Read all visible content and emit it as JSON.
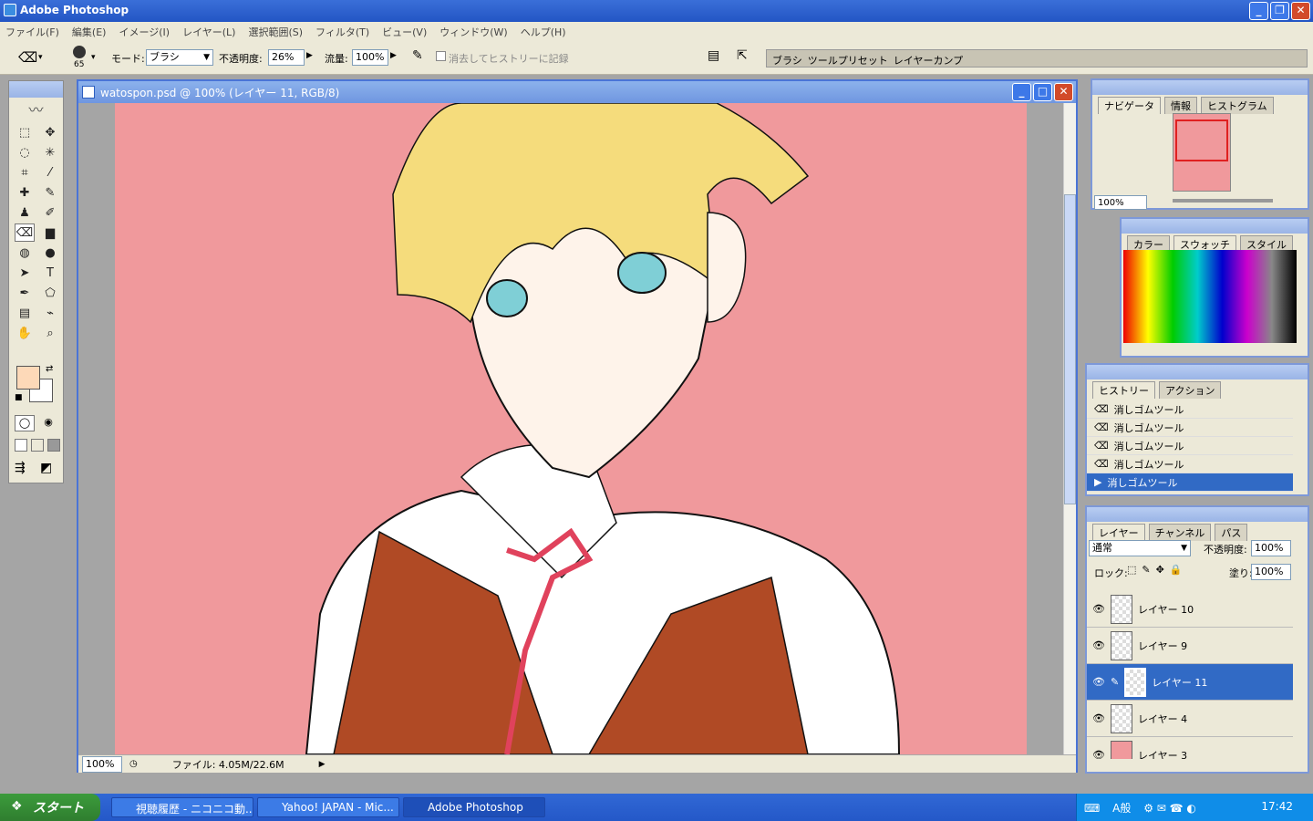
{
  "app": {
    "title": "Adobe Photoshop"
  },
  "menu": [
    "ファイル(F)",
    "編集(E)",
    "イメージ(I)",
    "レイヤー(L)",
    "選択範囲(S)",
    "フィルタ(T)",
    "ビュー(V)",
    "ウィンドウ(W)",
    "ヘルプ(H)"
  ],
  "options": {
    "brush_size": "65",
    "mode_label": "モード:",
    "mode_value": "ブラシ",
    "opacity_label": "不透明度:",
    "opacity_value": "26%",
    "flow_label": "流量:",
    "flow_value": "100%",
    "erase_history_label": "消去してヒストリーに記録",
    "well_tabs": [
      "ブラシ",
      "ツールプリセット",
      "レイヤーカンプ"
    ]
  },
  "document": {
    "title": "watospon.psd @ 100% (レイヤー 11, RGB/8)",
    "zoom": "100%",
    "file_info": "ファイル: 4.05M/22.6M"
  },
  "navigator": {
    "tabs": [
      "ナビゲータ",
      "情報",
      "ヒストグラム"
    ],
    "zoom": "100%"
  },
  "swatches": {
    "tabs": [
      "カラー",
      "スウォッチ",
      "スタイル"
    ]
  },
  "history": {
    "tabs": [
      "ヒストリー",
      "アクション"
    ],
    "items": [
      "消しゴムツール",
      "消しゴムツール",
      "消しゴムツール",
      "消しゴムツール",
      "消しゴムツール"
    ]
  },
  "layers": {
    "tabs": [
      "レイヤー",
      "チャンネル",
      "パス"
    ],
    "blend_mode": "通常",
    "opacity_label": "不透明度:",
    "opacity_value": "100%",
    "lock_label": "ロック:",
    "fill_label": "塗り:",
    "fill_value": "100%",
    "items": [
      "レイヤー 10",
      "レイヤー 9",
      "レイヤー 11",
      "レイヤー 4",
      "レイヤー 3"
    ]
  },
  "taskbar": {
    "start": "スタート",
    "tasks": [
      "視聴履歴 - ニコニコ動...",
      "Yahoo! JAPAN - Mic...",
      "Adobe Photoshop"
    ],
    "time": "17:42",
    "ime": "A般"
  },
  "colors": {
    "foreground": "#fdd9b8",
    "background": "#ffffff",
    "canvas_bg": "#f0999c",
    "selection": "#316ac5"
  }
}
